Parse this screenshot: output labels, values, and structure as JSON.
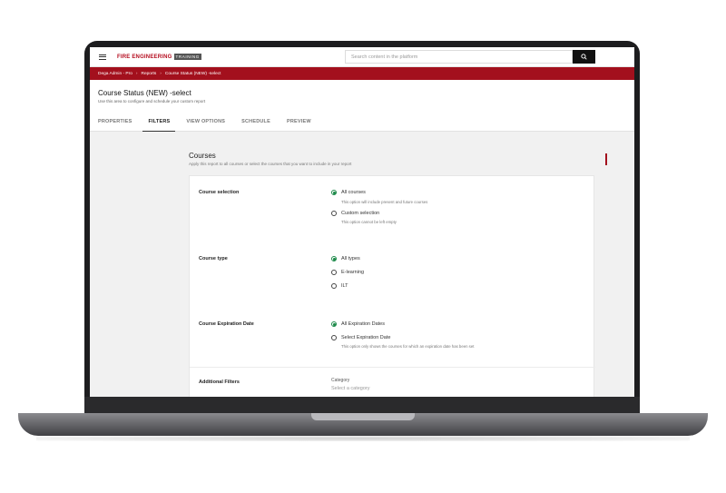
{
  "topbar": {
    "logo_main": "FIRE ENGINEERING",
    "logo_sub": "TRAINING",
    "search_placeholder": "Search content in the platform"
  },
  "breadcrumb": [
    "Dega Admin - Pro",
    "Reports",
    "Course Status (NEW) -select"
  ],
  "header": {
    "title": "Course Status (NEW) -select",
    "subtitle": "Use this area to configure and schedule your custom report",
    "tabs": [
      "PROPERTIES",
      "FILTERS",
      "VIEW OPTIONS",
      "SCHEDULE",
      "PREVIEW"
    ],
    "active_tab": "FILTERS"
  },
  "section": {
    "title": "Courses",
    "subtitle": "Apply this report to all courses or select the courses that you want to include in your report"
  },
  "filters": {
    "course_selection": {
      "label": "Course selection",
      "options": [
        {
          "label": "All courses",
          "desc": "This option will include present and future courses",
          "selected": true
        },
        {
          "label": "Custom selection",
          "desc": "This option cannot be left empty",
          "selected": false
        }
      ]
    },
    "course_type": {
      "label": "Course type",
      "options": [
        {
          "label": "All types",
          "selected": true
        },
        {
          "label": "E-learning",
          "selected": false
        },
        {
          "label": "ILT",
          "selected": false
        }
      ]
    },
    "expiration": {
      "label": "Course Expiration Date",
      "options": [
        {
          "label": "All Expiration Dates",
          "selected": true
        },
        {
          "label": "Select Expiration Date",
          "desc": "This option only shows the courses for which an expiration date has been set",
          "selected": false
        }
      ]
    },
    "additional": {
      "label": "Additional Filters",
      "category_label": "Category",
      "category_placeholder": "Select a category"
    }
  },
  "colors": {
    "brand_red": "#a3101d",
    "radio_green": "#1d8a4a"
  }
}
